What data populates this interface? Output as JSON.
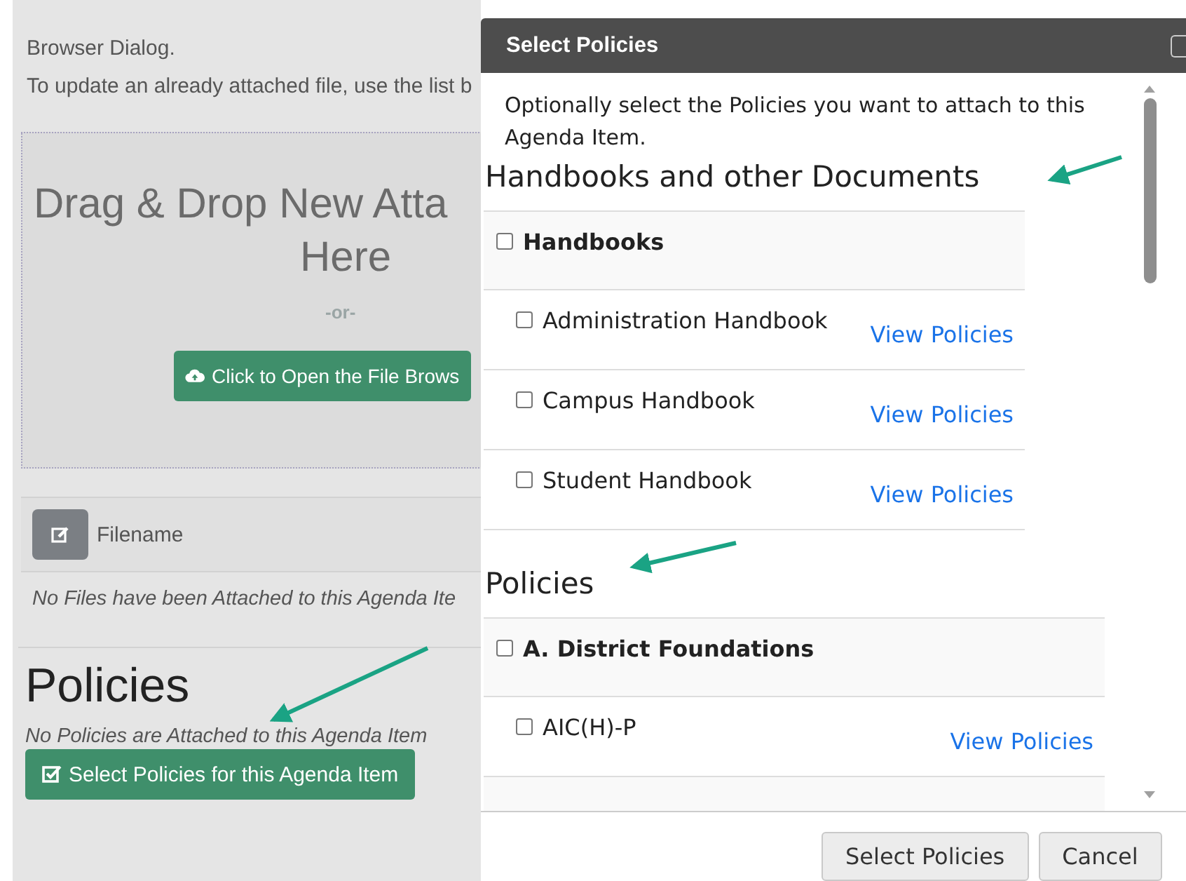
{
  "background_page": {
    "intro_lines": [
      "Browser Dialog.",
      "To update an already attached file, use the list b"
    ],
    "dropzone": {
      "title": "Drag & Drop New Atta",
      "title_line2": "Here",
      "separator": "-or-",
      "button": "Click to Open the File Brows"
    },
    "files_table": {
      "column": "Filename",
      "empty_message": "No Files have been Attached to this Agenda Ite"
    },
    "policies": {
      "heading": "Policies",
      "empty_message": "No Policies are Attached to this Agenda Item",
      "button": "Select Policies for this Agenda Item"
    }
  },
  "dialog": {
    "title": "Select Policies",
    "intro": "Optionally select the Policies you want to attach to this Agenda Item.",
    "sections": [
      {
        "heading": "Handbooks and other Documents",
        "groups": [
          {
            "label": "Handbooks",
            "checked": false,
            "items": [
              {
                "label": "Administration Handbook",
                "checked": false,
                "link": "View Policies"
              },
              {
                "label": "Campus Handbook",
                "checked": false,
                "link": "View Policies"
              },
              {
                "label": "Student Handbook",
                "checked": false,
                "link": "View Policies"
              }
            ]
          }
        ]
      },
      {
        "heading": "Policies",
        "groups": [
          {
            "label": "A. District Foundations",
            "checked": false,
            "items": [
              {
                "label": "AIC(H)-P",
                "checked": false,
                "link": "View Policies"
              }
            ]
          }
        ]
      }
    ],
    "buttons": [
      "Select Policies",
      "Cancel"
    ]
  }
}
